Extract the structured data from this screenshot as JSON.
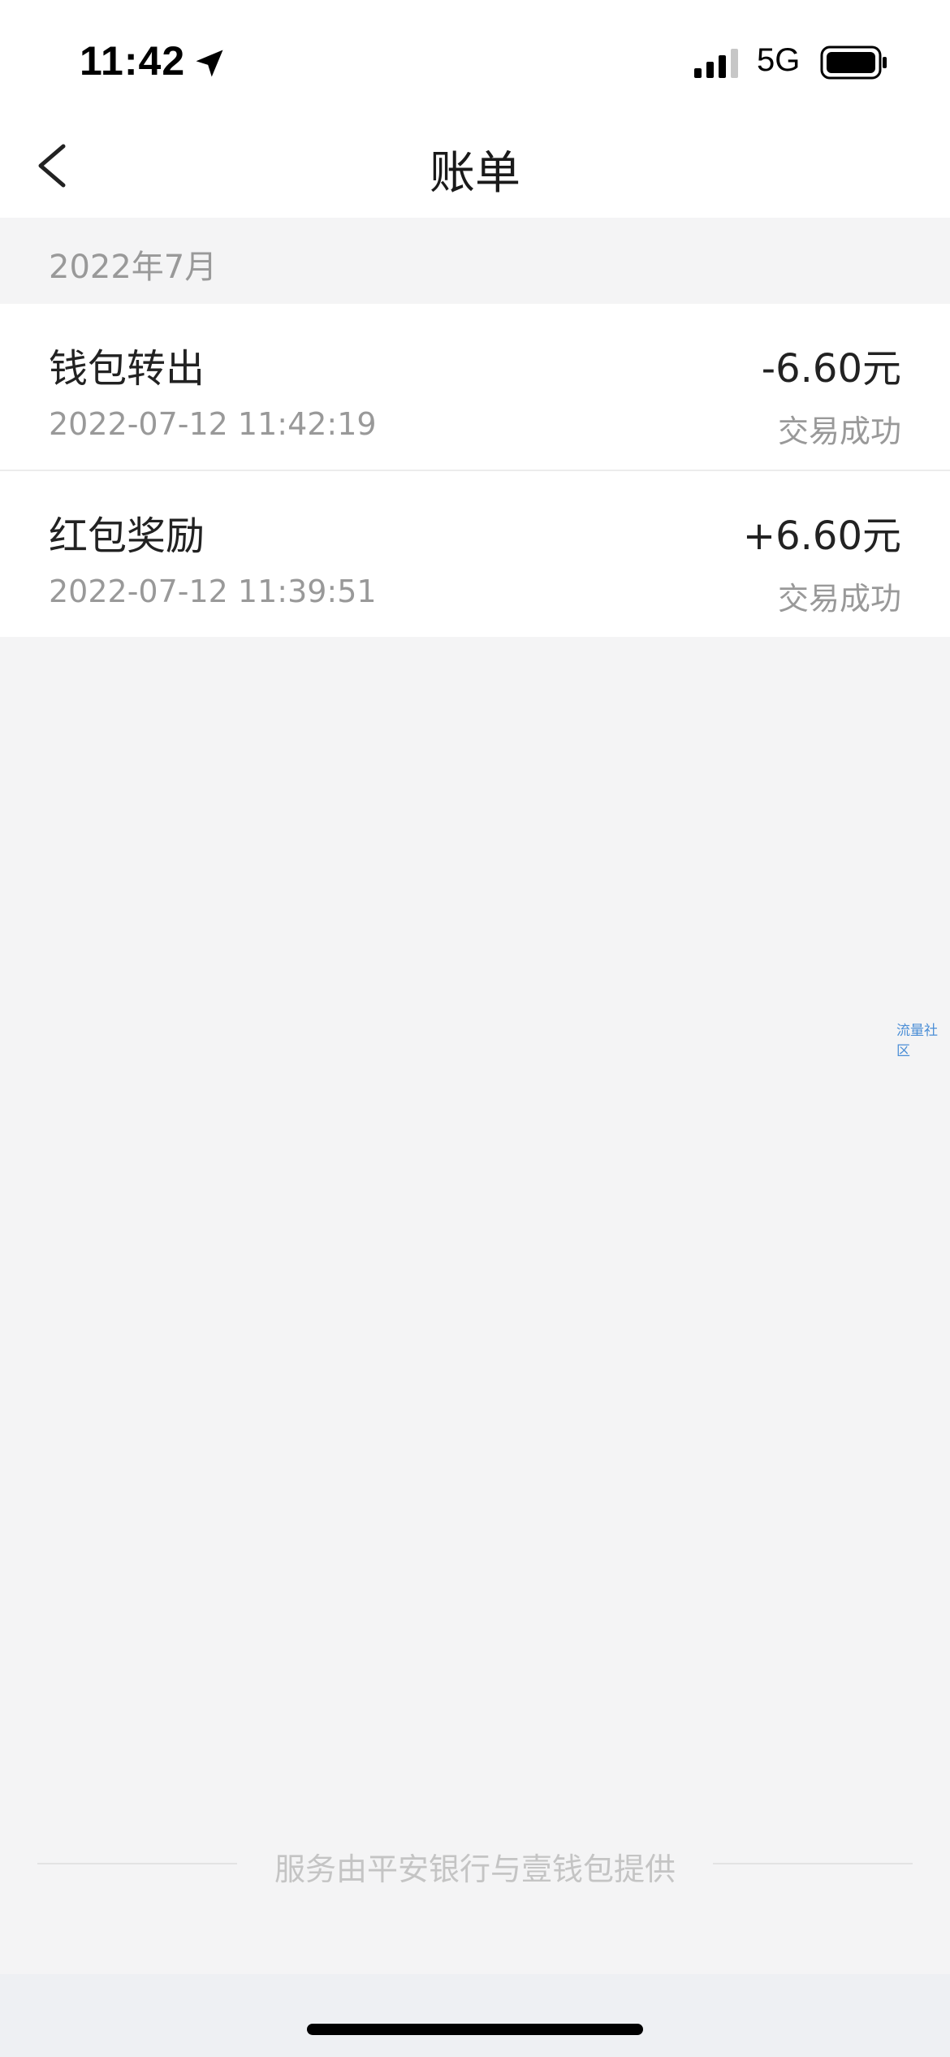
{
  "status_bar": {
    "time": "11:42",
    "network": "5G",
    "icons": [
      "location-arrow-icon",
      "signal-bars-icon",
      "battery-icon"
    ]
  },
  "nav": {
    "title": "账单",
    "back_icon": "chevron-left-icon"
  },
  "month": {
    "label": "2022年7月"
  },
  "bills": [
    {
      "title": "钱包转出",
      "amount": "-6.60元",
      "time": "2022-07-12 11:42:19",
      "status": "交易成功"
    },
    {
      "title": "红包奖励",
      "amount": "+6.60元",
      "time": "2022-07-12 11:39:51",
      "status": "交易成功"
    }
  ],
  "watermark": "流量社区",
  "footer": {
    "text": "服务由平安银行与壹钱包提供"
  },
  "colors": {
    "background": "#f4f4f5",
    "surface": "#ffffff",
    "primary_text": "#222222",
    "secondary_text": "#999999",
    "footer_text": "#c4c4c4",
    "watermark": "#4b8ed6"
  }
}
